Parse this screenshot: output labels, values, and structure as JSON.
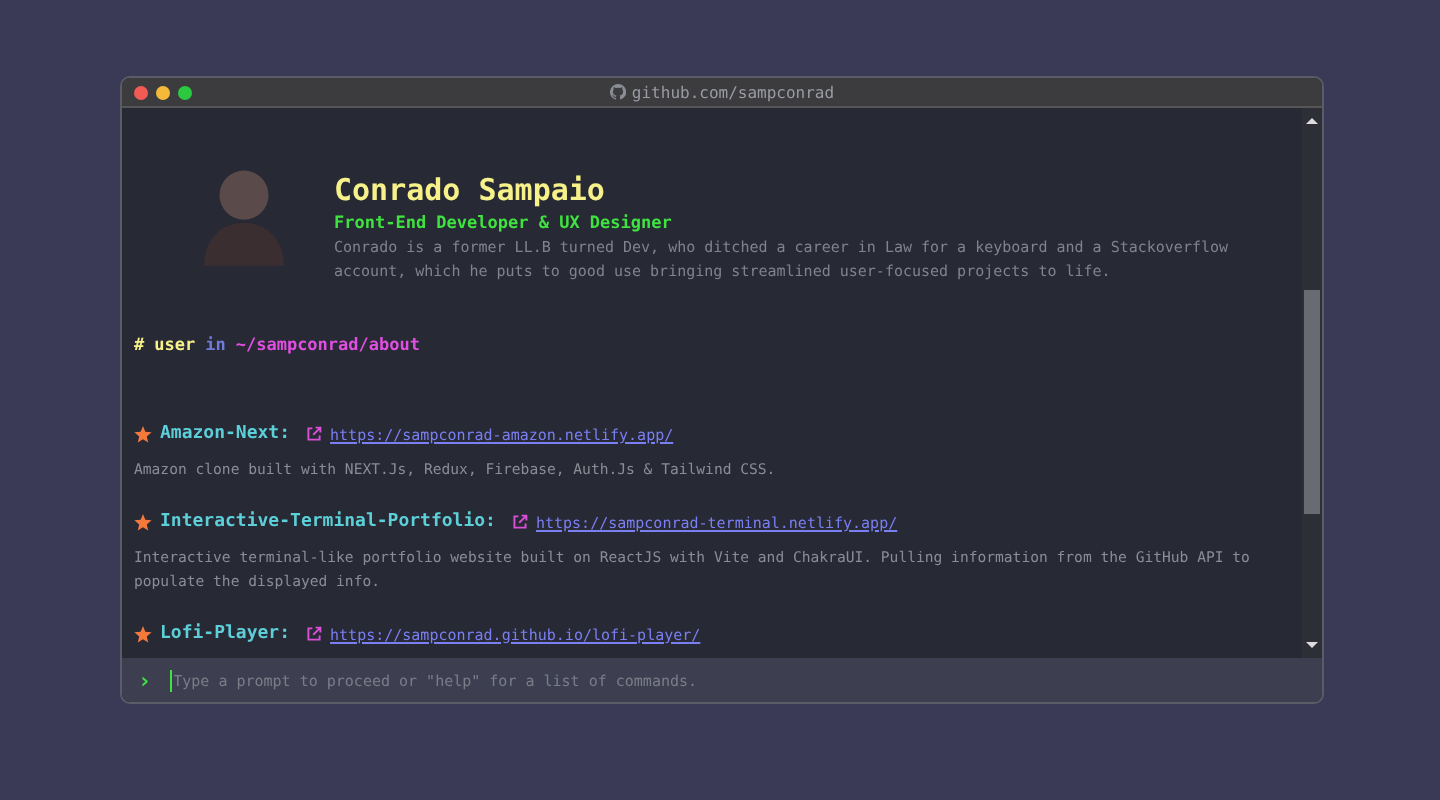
{
  "window": {
    "title": "github.com/sampconrad"
  },
  "profile": {
    "name": "Conrado Sampaio",
    "role": "Front-End Developer & UX Designer",
    "bio": "Conrado is a former LL.B turned Dev, who ditched a career in Law for a keyboard and a Stackoverflow account, which he puts to good use bringing streamlined user-focused projects to life."
  },
  "command": {
    "hash": "#",
    "user": "user",
    "in": "in",
    "path": "~/sampconrad/about"
  },
  "projects": [
    {
      "name": "Amazon-Next:",
      "url": "https://sampconrad-amazon.netlify.app/",
      "description": "Amazon clone built with NEXT.Js, Redux, Firebase, Auth.Js & Tailwind CSS."
    },
    {
      "name": "Interactive-Terminal-Portfolio:",
      "url": "https://sampconrad-terminal.netlify.app/",
      "description": "Interactive terminal-like portfolio website built on ReactJS with Vite and ChakraUI. Pulling information from the GitHub API to populate the displayed info."
    },
    {
      "name": "Lofi-Player:",
      "url": "https://sampconrad.github.io/lofi-player/"
    }
  ],
  "prompt": {
    "symbol": "›",
    "placeholder": "Type a prompt to proceed or \"help\" for a list of commands."
  }
}
